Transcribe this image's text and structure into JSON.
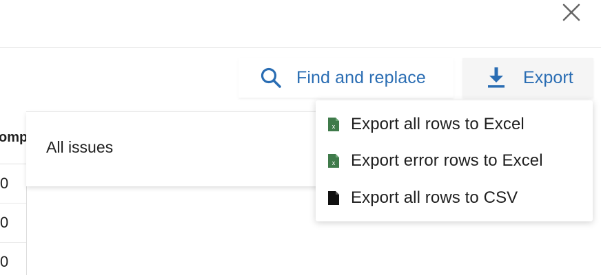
{
  "dialog": {
    "close_icon": "close-icon"
  },
  "toolbar": {
    "find_replace": {
      "label": "Find and replace",
      "icon": "search-icon"
    },
    "export": {
      "label": "Export",
      "icon": "download-icon"
    }
  },
  "table": {
    "header_partial": "omp",
    "cells": [
      "0",
      "0",
      "0"
    ]
  },
  "issues_panel": {
    "label": "All issues"
  },
  "export_menu": {
    "items": [
      {
        "label": "Export all rows to Excel",
        "icon": "excel-file-icon"
      },
      {
        "label": "Export error rows to Excel",
        "icon": "excel-file-icon"
      },
      {
        "label": "Export all rows to CSV",
        "icon": "file-icon"
      }
    ]
  },
  "colors": {
    "accent": "#2a6db3",
    "excel_green": "#3f7a4a",
    "text": "#1f1f1f"
  }
}
